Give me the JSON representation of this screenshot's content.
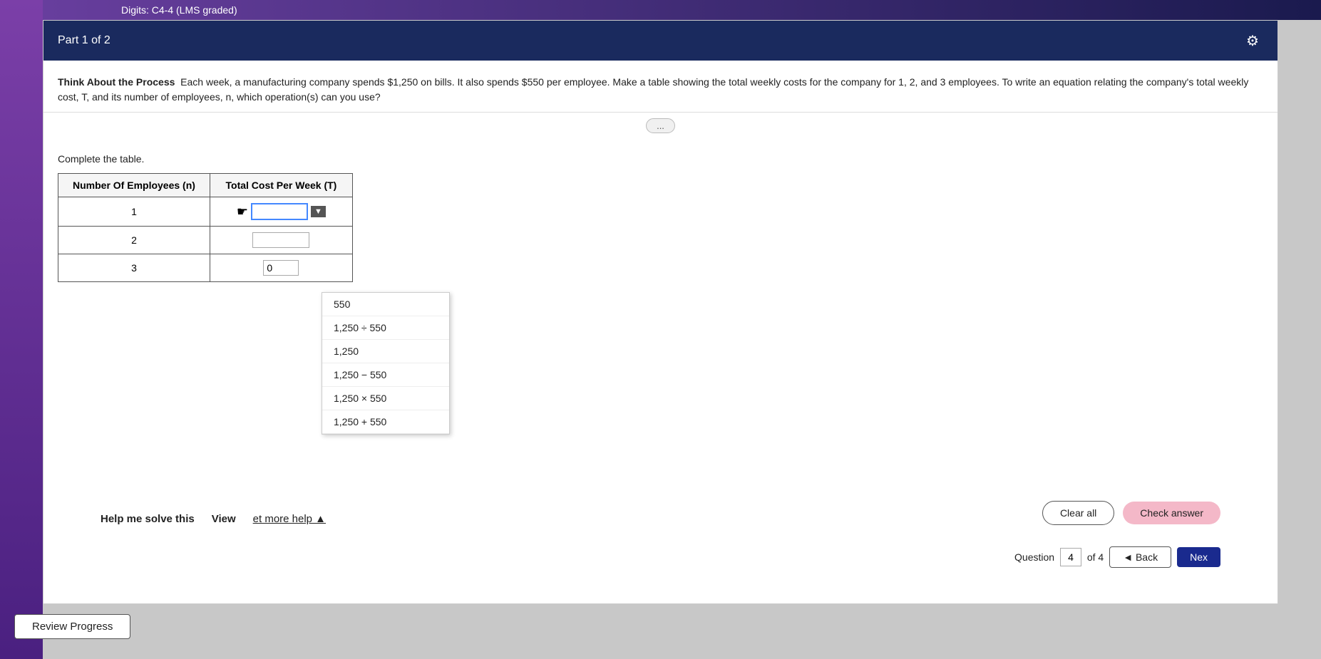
{
  "topBar": {
    "title": "Digits: C4-4 (LMS graded)"
  },
  "partHeader": {
    "label": "Part 1 of 2"
  },
  "question": {
    "bold": "Think About the Process",
    "text": "Each week, a manufacturing company spends $1,250 on bills. It also spends $550 per employee. Make a table showing the total weekly costs for the company for 1, 2, and 3 employees. To write an equation relating the company's total weekly cost, T, and its number of employees, n, which operation(s) can you use?",
    "and_word": "and"
  },
  "expandBtn": {
    "label": "..."
  },
  "completeLabel": "Complete the table.",
  "table": {
    "col1Header": "Number Of Employees (n)",
    "col2Header": "Total Cost Per Week (T)",
    "rows": [
      {
        "n": "1",
        "t": ""
      },
      {
        "n": "2",
        "t": ""
      },
      {
        "n": "3",
        "t": "0"
      }
    ]
  },
  "dropdownOptions": [
    {
      "label": "550"
    },
    {
      "label": "1,250 ÷ 550"
    },
    {
      "label": "1,250"
    },
    {
      "label": "1,250 − 550"
    },
    {
      "label": "1,250 × 550"
    },
    {
      "label": "1,250 + 550"
    }
  ],
  "buttons": {
    "clearAll": "Clear all",
    "checkAnswer": "Check answer",
    "helpMeSolve": "Help me solve this",
    "viewAnExample": "View",
    "getMoreHelp": "et more help ▲"
  },
  "navigation": {
    "questionLabel": "Question",
    "currentQuestion": "4",
    "totalQuestions": "of 4",
    "backBtn": "◄ Back",
    "nextBtn": "Nex"
  },
  "reviewProgress": {
    "label": "Review Progress"
  },
  "gearIcon": "⚙"
}
